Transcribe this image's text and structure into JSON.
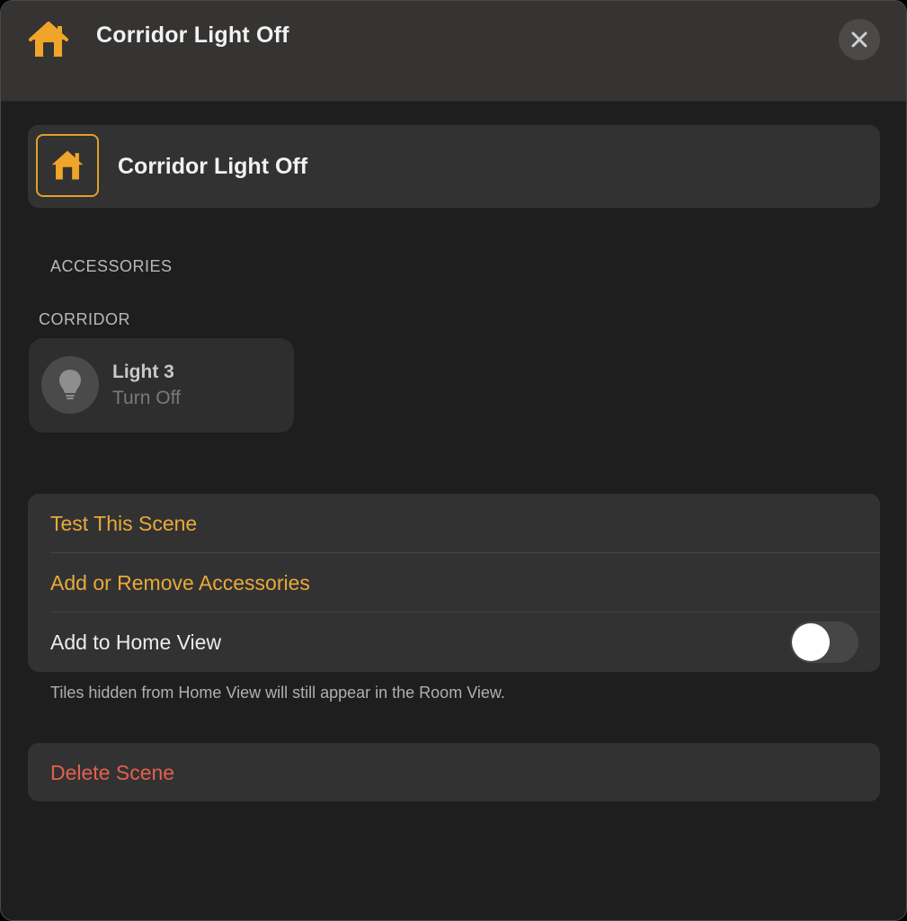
{
  "window": {
    "title": "Corridor Light Off",
    "close_icon": "close-icon",
    "title_icon": "home-icon"
  },
  "scene": {
    "name": "Corridor Light Off",
    "icon": "home-icon"
  },
  "accessories_section": {
    "header": "ACCESSORIES",
    "room_header": "CORRIDOR",
    "items": [
      {
        "name": "Light 3",
        "status": "Turn Off",
        "icon": "lightbulb-icon"
      }
    ]
  },
  "actions": {
    "test_scene": "Test This Scene",
    "add_remove_accessories": "Add or Remove Accessories",
    "add_to_home_view": "Add to Home View",
    "add_to_home_view_enabled": false
  },
  "footnote": "Tiles hidden from Home View will still appear in the Room View.",
  "delete": {
    "label": "Delete Scene"
  },
  "colors": {
    "accent": "#e9a93a",
    "destructive": "#e2604e",
    "background": "#1e1e1e",
    "card": "#323232",
    "titlebar": "#353433"
  }
}
